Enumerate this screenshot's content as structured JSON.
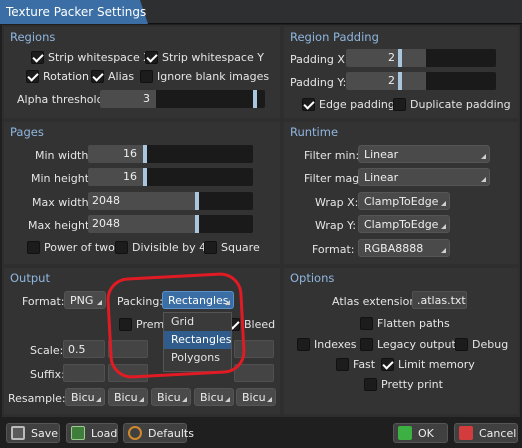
{
  "window": {
    "title": "Texture Packer Settings"
  },
  "regions": {
    "header": "Regions",
    "strip_x": {
      "label": "Strip whitespace X",
      "checked": true
    },
    "strip_y": {
      "label": "Strip whitespace Y",
      "checked": true
    },
    "rotation": {
      "label": "Rotation",
      "checked": true
    },
    "alias": {
      "label": "Alias",
      "checked": true
    },
    "ignore_blank": {
      "label": "Ignore blank images",
      "checked": false
    },
    "alpha_threshold": {
      "label": "Alpha threshold:",
      "value": "3"
    }
  },
  "region_padding": {
    "header": "Region Padding",
    "padding_x": {
      "label": "Padding X:",
      "value": "2"
    },
    "padding_y": {
      "label": "Padding Y:",
      "value": "2"
    },
    "edge_padding": {
      "label": "Edge padding",
      "checked": true
    },
    "duplicate_padding": {
      "label": "Duplicate padding",
      "checked": false
    }
  },
  "pages": {
    "header": "Pages",
    "min_width": {
      "label": "Min width:",
      "value": "16"
    },
    "min_height": {
      "label": "Min height:",
      "value": "16"
    },
    "max_width": {
      "label": "Max width:",
      "value": "2048"
    },
    "max_height": {
      "label": "Max height:",
      "value": "2048"
    },
    "power_of_two": {
      "label": "Power of two",
      "checked": false
    },
    "divisible_by_4": {
      "label": "Divisible by 4",
      "checked": false
    },
    "square": {
      "label": "Square",
      "checked": false
    }
  },
  "runtime": {
    "header": "Runtime",
    "filter_min": {
      "label": "Filter min:",
      "value": "Linear"
    },
    "filter_mag": {
      "label": "Filter mag:",
      "value": "Linear"
    },
    "wrap_x": {
      "label": "Wrap X:",
      "value": "ClampToEdge"
    },
    "wrap_y": {
      "label": "Wrap Y:",
      "value": "ClampToEdge"
    },
    "format": {
      "label": "Format:",
      "value": "RGBA8888"
    }
  },
  "output": {
    "header": "Output",
    "format": {
      "label": "Format:",
      "value": "PNG"
    },
    "packing": {
      "label": "Packing:",
      "value": "Rectangles"
    },
    "premultiply": {
      "label": "Prem",
      "checked": false
    },
    "bleed": {
      "label": "Bleed",
      "checked": true
    },
    "scale": {
      "label": "Scale:",
      "value": "0.5"
    },
    "suffix": {
      "label": "Suffix:"
    },
    "resample": {
      "label": "Resample:",
      "values": [
        "Bicu",
        "Bicu",
        "Bicu",
        "Bicu",
        "Bicu"
      ]
    },
    "packing_options": [
      "Grid",
      "Rectangles",
      "Polygons"
    ],
    "packing_selected": "Rectangles"
  },
  "options": {
    "header": "Options",
    "atlas_extension": {
      "label": "Atlas extension:",
      "value": ".atlas.txt"
    },
    "flatten_paths": {
      "label": "Flatten paths",
      "checked": false
    },
    "indexes": {
      "label": "Indexes",
      "checked": false
    },
    "legacy_output": {
      "label": "Legacy output",
      "checked": false
    },
    "debug": {
      "label": "Debug",
      "checked": false
    },
    "fast": {
      "label": "Fast",
      "checked": false
    },
    "limit_memory": {
      "label": "Limit memory",
      "checked": true
    },
    "pretty_print": {
      "label": "Pretty print",
      "checked": false
    }
  },
  "footer": {
    "save": "Save",
    "load": "Load",
    "defaults": "Defaults",
    "ok": "OK",
    "cancel": "Cancel"
  },
  "colors": {
    "accent": "#3a6ea5",
    "header_text": "#8fb6e0",
    "annotation_circle": "#e01b24",
    "ok_icon": "#3cb043",
    "cancel_icon": "#d23c3c"
  },
  "annotation": {
    "type": "hand-drawn red circle",
    "target": "packing-dropdown-popup"
  }
}
